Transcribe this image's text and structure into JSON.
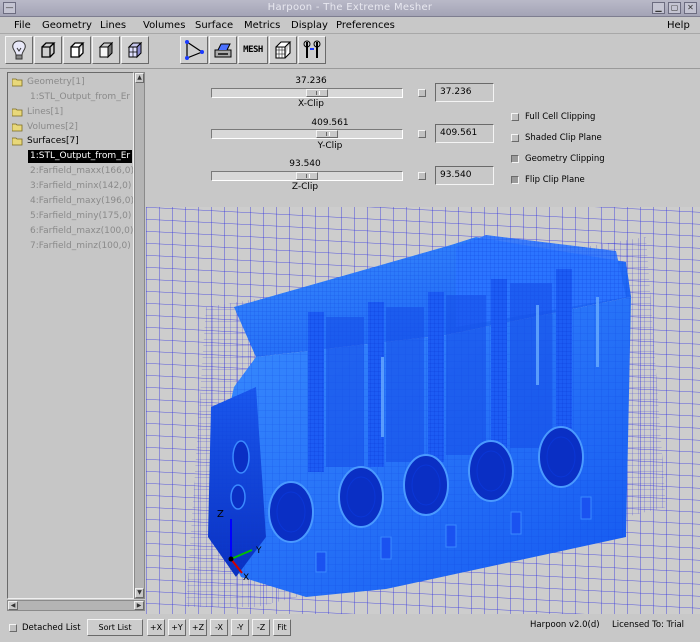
{
  "window": {
    "title": "Harpoon - The Extreme Mesher"
  },
  "menu": {
    "file": "File",
    "geometry": "Geometry",
    "lines": "Lines",
    "volumes": "Volumes",
    "surface": "Surface",
    "metrics": "Metrics",
    "display": "Display",
    "preferences": "Preferences",
    "help": "Help"
  },
  "toolbar": {
    "mesh_label": "MESH"
  },
  "tree": {
    "geometry": "Geometry[1]",
    "geometry_child": "1:STL_Output_from_Er",
    "lines": "Lines[1]",
    "volumes": "Volumes[2]",
    "surfaces": "Surfaces[7]",
    "surface_items": [
      "1:STL_Output_from_Er",
      "2:Farfield_maxx(166,0)",
      "3:Farfield_minx(142,0)",
      "4:Farfield_maxy(196,0)",
      "5:Farfield_miny(175,0)",
      "6:Farfield_maxz(100,0)",
      "7:Farfield_minz(100,0)"
    ]
  },
  "clip": {
    "x": {
      "value_top": "37.236",
      "label": "X-Clip",
      "field": "37.236",
      "position": 0.56
    },
    "y": {
      "value_top": "409.561",
      "label": "Y-Clip",
      "field": "409.561",
      "position": 0.62
    },
    "z": {
      "value_top": "93.540",
      "label": "Z-Clip",
      "field": "93.540",
      "position": 0.5
    }
  },
  "options": {
    "full_cell": {
      "label": "Full Cell Clipping",
      "checked": false
    },
    "shaded": {
      "label": "Shaded Clip Plane",
      "checked": false
    },
    "geometry": {
      "label": "Geometry Clipping",
      "checked": true
    },
    "flip": {
      "label": "Flip Clip Plane",
      "checked": true
    }
  },
  "axes": {
    "z": "Z",
    "y": "Y",
    "x": "X"
  },
  "bottom": {
    "detached": "Detached List",
    "sort": "Sort List",
    "views": [
      "+X",
      "+Y",
      "+Z",
      "-X",
      "-Y",
      "-Z",
      "Fit"
    ],
    "version": "Harpoon v2.0(d)",
    "license": "Licensed To: Trial"
  },
  "colors": {
    "mesh": "#1a6bff",
    "mesh_dark": "#0a3ad8",
    "grid": "#3c3ce0",
    "background": "#cdcdcd"
  },
  "icons": [
    "lightbulb-icon",
    "cube-solid-icon",
    "cube-wire-icon",
    "cube-shaded-icon",
    "cube-grid-icon",
    "triangle-nodes-icon",
    "printer-icon",
    "mesh-icon",
    "cube-mesh-icon",
    "tools-icon"
  ]
}
